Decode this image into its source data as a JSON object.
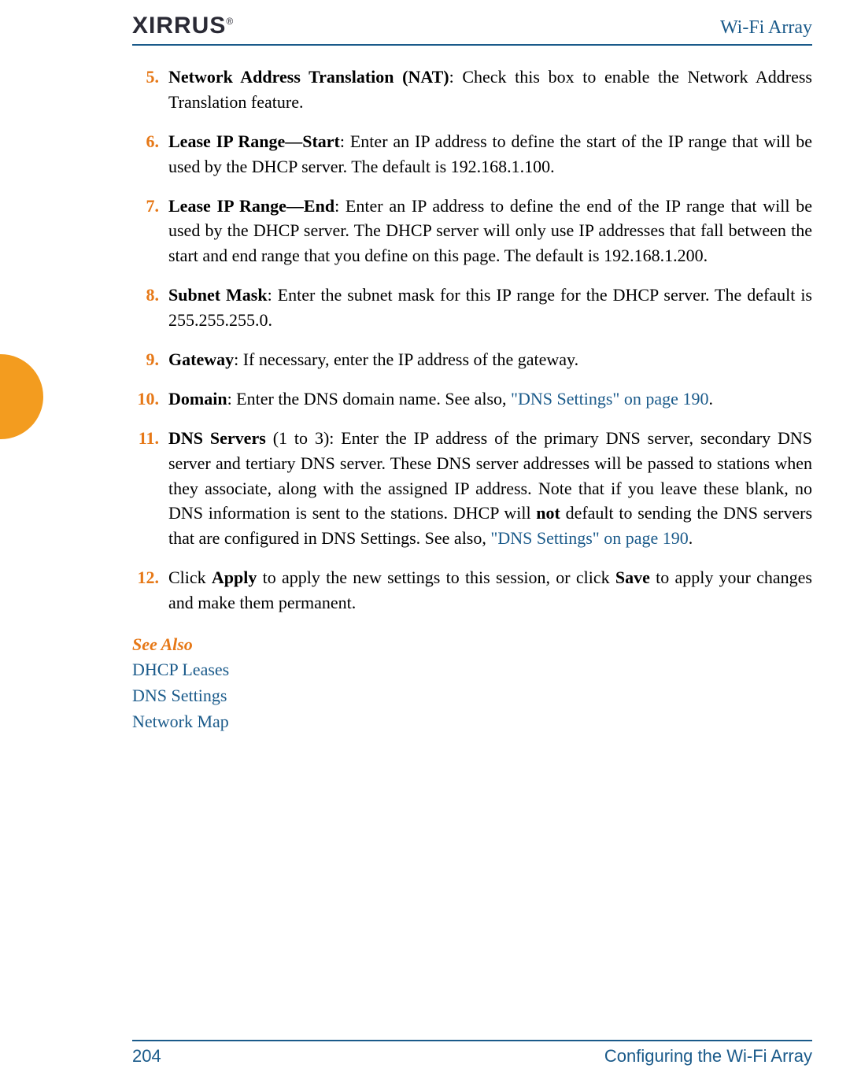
{
  "header": {
    "logo_text": "XIRRUS",
    "logo_reg": "®",
    "title": "Wi-Fi Array"
  },
  "items": [
    {
      "num": "5.",
      "term": "Network Address Translation (NAT)",
      "rest": ": Check this box to enable the Network Address Translation feature."
    },
    {
      "num": "6.",
      "term": "Lease IP Range—Start",
      "rest": ": Enter an IP address to define the start of the IP range that will be used by the DHCP server. The default is 192.168.1.100."
    },
    {
      "num": "7.",
      "term": "Lease IP Range—End",
      "rest": ": Enter an IP address to define the end of the IP range that will be used by the DHCP server. The DHCP server will only use IP addresses that fall between the start and end range that you define on this page. The default is 192.168.1.200."
    },
    {
      "num": "8.",
      "term": "Subnet Mask",
      "rest": ": Enter the subnet mask for this IP range for the DHCP server. The default is 255.255.255.0."
    },
    {
      "num": "9.",
      "term": "Gateway",
      "rest": ": If necessary, enter the IP address of the gateway."
    },
    {
      "num": "10.",
      "term": "Domain",
      "rest_pre": ": Enter the DNS domain name. See also, ",
      "link": "\"DNS Settings\" on page 190",
      "rest_post": "."
    },
    {
      "num": "11.",
      "term": "DNS Servers",
      "mid1": " (1 to 3): Enter the IP address of the primary DNS server, secondary DNS server and tertiary DNS server. These DNS server addresses will be passed to stations when they associate, along with the assigned IP address. Note that if you leave these blank, no DNS information is sent to the stations. DHCP will ",
      "bold1": "not",
      "mid2": " default to sending the DNS servers that are configured in DNS Settings. See also, ",
      "link": "\"DNS Settings\" on page 190",
      "rest_post": "."
    },
    {
      "num": "12.",
      "pre": "Click ",
      "bold1": "Apply",
      "mid1": " to apply the new settings to this session, or click ",
      "bold2": "Save",
      "post": " to apply your changes and make them permanent."
    }
  ],
  "see_also": {
    "heading": "See Also",
    "links": [
      "DHCP Leases",
      "DNS Settings",
      "Network Map"
    ]
  },
  "footer": {
    "page": "204",
    "title": "Configuring the Wi-Fi Array"
  }
}
